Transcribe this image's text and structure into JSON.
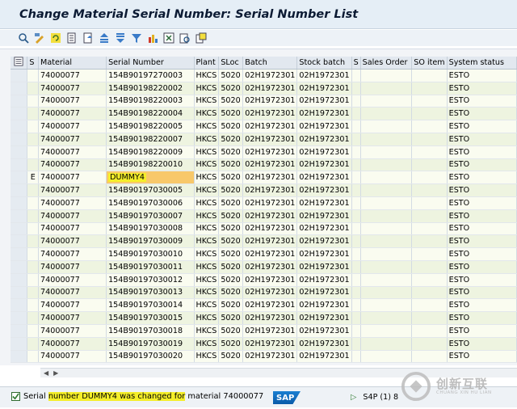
{
  "window": {
    "title": "Change Material Serial Number: Serial Number List"
  },
  "toolbar": {
    "icons": [
      "details-icon",
      "change-icon",
      "refresh-icon",
      "choose-icon",
      "save-variant-icon",
      "sort-ascending-icon",
      "sort-descending-icon",
      "filter-icon",
      "graphic-icon",
      "excel-export-icon",
      "print-preview-icon",
      "layout-icon"
    ]
  },
  "colors": {
    "title_bg": "#e5eef6",
    "row_light": "#fafcf0",
    "row_dark": "#eef4e0",
    "edited_cell": "#f8c86a",
    "highlight_yellow": "#f4ee29"
  },
  "table": {
    "columns": [
      "S",
      "Material",
      "Serial Number",
      "Plant",
      "SLoc",
      "Batch",
      "Stock batch",
      "S",
      "Sales Order",
      "SO item",
      "System status"
    ],
    "rows": [
      {
        "s": "",
        "material": "74000077",
        "serial": "154B90197270003",
        "plant": "HKCS",
        "sloc": "5020",
        "batch": "02H1972301",
        "stock_batch": "02H1972301",
        "s2": "",
        "sales_order": "",
        "so_item": "",
        "status": "ESTO"
      },
      {
        "s": "",
        "material": "74000077",
        "serial": "154B90198220002",
        "plant": "HKCS",
        "sloc": "5020",
        "batch": "02H1972301",
        "stock_batch": "02H1972301",
        "s2": "",
        "sales_order": "",
        "so_item": "",
        "status": "ESTO"
      },
      {
        "s": "",
        "material": "74000077",
        "serial": "154B90198220003",
        "plant": "HKCS",
        "sloc": "5020",
        "batch": "02H1972301",
        "stock_batch": "02H1972301",
        "s2": "",
        "sales_order": "",
        "so_item": "",
        "status": "ESTO"
      },
      {
        "s": "",
        "material": "74000077",
        "serial": "154B90198220004",
        "plant": "HKCS",
        "sloc": "5020",
        "batch": "02H1972301",
        "stock_batch": "02H1972301",
        "s2": "",
        "sales_order": "",
        "so_item": "",
        "status": "ESTO"
      },
      {
        "s": "",
        "material": "74000077",
        "serial": "154B90198220005",
        "plant": "HKCS",
        "sloc": "5020",
        "batch": "02H1972301",
        "stock_batch": "02H1972301",
        "s2": "",
        "sales_order": "",
        "so_item": "",
        "status": "ESTO"
      },
      {
        "s": "",
        "material": "74000077",
        "serial": "154B90198220007",
        "plant": "HKCS",
        "sloc": "5020",
        "batch": "02H1972301",
        "stock_batch": "02H1972301",
        "s2": "",
        "sales_order": "",
        "so_item": "",
        "status": "ESTO"
      },
      {
        "s": "",
        "material": "74000077",
        "serial": "154B90198220009",
        "plant": "HKCS",
        "sloc": "5020",
        "batch": "02H1972301",
        "stock_batch": "02H1972301",
        "s2": "",
        "sales_order": "",
        "so_item": "",
        "status": "ESTO"
      },
      {
        "s": "",
        "material": "74000077",
        "serial": "154B90198220010",
        "plant": "HKCS",
        "sloc": "5020",
        "batch": "02H1972301",
        "stock_batch": "02H1972301",
        "s2": "",
        "sales_order": "",
        "so_item": "",
        "status": "ESTO"
      },
      {
        "s": "E",
        "material": "74000077",
        "serial": "DUMMY4",
        "plant": "HKCS",
        "sloc": "5020",
        "batch": "02H1972301",
        "stock_batch": "02H1972301",
        "s2": "",
        "sales_order": "",
        "so_item": "",
        "status": "ESTO",
        "edited": true
      },
      {
        "s": "",
        "material": "74000077",
        "serial": "154B90197030005",
        "plant": "HKCS",
        "sloc": "5020",
        "batch": "02H1972301",
        "stock_batch": "02H1972301",
        "s2": "",
        "sales_order": "",
        "so_item": "",
        "status": "ESTO"
      },
      {
        "s": "",
        "material": "74000077",
        "serial": "154B90197030006",
        "plant": "HKCS",
        "sloc": "5020",
        "batch": "02H1972301",
        "stock_batch": "02H1972301",
        "s2": "",
        "sales_order": "",
        "so_item": "",
        "status": "ESTO"
      },
      {
        "s": "",
        "material": "74000077",
        "serial": "154B90197030007",
        "plant": "HKCS",
        "sloc": "5020",
        "batch": "02H1972301",
        "stock_batch": "02H1972301",
        "s2": "",
        "sales_order": "",
        "so_item": "",
        "status": "ESTO"
      },
      {
        "s": "",
        "material": "74000077",
        "serial": "154B90197030008",
        "plant": "HKCS",
        "sloc": "5020",
        "batch": "02H1972301",
        "stock_batch": "02H1972301",
        "s2": "",
        "sales_order": "",
        "so_item": "",
        "status": "ESTO"
      },
      {
        "s": "",
        "material": "74000077",
        "serial": "154B90197030009",
        "plant": "HKCS",
        "sloc": "5020",
        "batch": "02H1972301",
        "stock_batch": "02H1972301",
        "s2": "",
        "sales_order": "",
        "so_item": "",
        "status": "ESTO"
      },
      {
        "s": "",
        "material": "74000077",
        "serial": "154B90197030010",
        "plant": "HKCS",
        "sloc": "5020",
        "batch": "02H1972301",
        "stock_batch": "02H1972301",
        "s2": "",
        "sales_order": "",
        "so_item": "",
        "status": "ESTO"
      },
      {
        "s": "",
        "material": "74000077",
        "serial": "154B90197030011",
        "plant": "HKCS",
        "sloc": "5020",
        "batch": "02H1972301",
        "stock_batch": "02H1972301",
        "s2": "",
        "sales_order": "",
        "so_item": "",
        "status": "ESTO"
      },
      {
        "s": "",
        "material": "74000077",
        "serial": "154B90197030012",
        "plant": "HKCS",
        "sloc": "5020",
        "batch": "02H1972301",
        "stock_batch": "02H1972301",
        "s2": "",
        "sales_order": "",
        "so_item": "",
        "status": "ESTO"
      },
      {
        "s": "",
        "material": "74000077",
        "serial": "154B90197030013",
        "plant": "HKCS",
        "sloc": "5020",
        "batch": "02H1972301",
        "stock_batch": "02H1972301",
        "s2": "",
        "sales_order": "",
        "so_item": "",
        "status": "ESTO"
      },
      {
        "s": "",
        "material": "74000077",
        "serial": "154B90197030014",
        "plant": "HKCS",
        "sloc": "5020",
        "batch": "02H1972301",
        "stock_batch": "02H1972301",
        "s2": "",
        "sales_order": "",
        "so_item": "",
        "status": "ESTO"
      },
      {
        "s": "",
        "material": "74000077",
        "serial": "154B90197030015",
        "plant": "HKCS",
        "sloc": "5020",
        "batch": "02H1972301",
        "stock_batch": "02H1972301",
        "s2": "",
        "sales_order": "",
        "so_item": "",
        "status": "ESTO"
      },
      {
        "s": "",
        "material": "74000077",
        "serial": "154B90197030018",
        "plant": "HKCS",
        "sloc": "5020",
        "batch": "02H1972301",
        "stock_batch": "02H1972301",
        "s2": "",
        "sales_order": "",
        "so_item": "",
        "status": "ESTO"
      },
      {
        "s": "",
        "material": "74000077",
        "serial": "154B90197030019",
        "plant": "HKCS",
        "sloc": "5020",
        "batch": "02H1972301",
        "stock_batch": "02H1972301",
        "s2": "",
        "sales_order": "",
        "so_item": "",
        "status": "ESTO"
      },
      {
        "s": "",
        "material": "74000077",
        "serial": "154B90197030020",
        "plant": "HKCS",
        "sloc": "5020",
        "batch": "02H1972301",
        "stock_batch": "02H1972301",
        "s2": "",
        "sales_order": "",
        "so_item": "",
        "status": "ESTO"
      }
    ]
  },
  "status_bar": {
    "message": "Serial number DUMMY4 was changed for material 74000077",
    "logo": "SAP",
    "system": "S4P (1) 8"
  },
  "watermark": {
    "main": "创新互联",
    "sub": "CHUANG XIN HU LIAN"
  }
}
